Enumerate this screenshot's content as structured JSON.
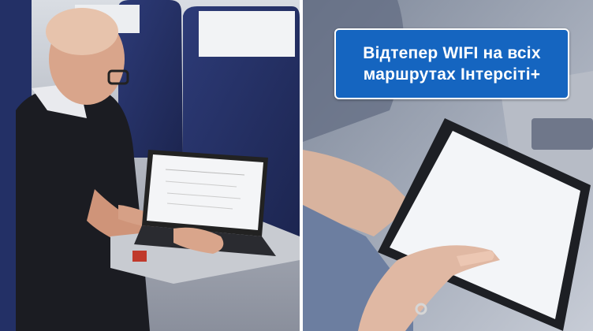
{
  "banner": {
    "line1": "Відтепер WIFI на всіх",
    "line2": "маршрутах Інтерсіті+",
    "background": "#1565c0",
    "text_color": "#ffffff"
  },
  "scenes": {
    "left": "man using laptop on train seat",
    "right": "hand using tablet on train"
  }
}
